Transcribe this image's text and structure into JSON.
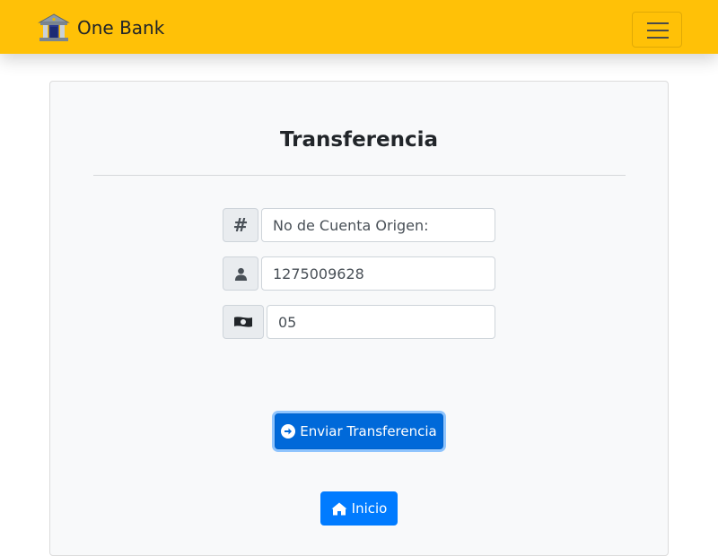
{
  "navbar": {
    "brand_name": "One Bank",
    "brand_icon": "bank-building-icon",
    "toggler_icon": "hamburger-menu-icon",
    "background_color": "#ffc107"
  },
  "form": {
    "title": "Transferencia",
    "source_account": {
      "icon": "hash-icon",
      "icon_glyph": "#",
      "placeholder": "No de Cuenta Origen:",
      "value": ""
    },
    "destination_account": {
      "icon": "user-icon",
      "value": "1275009628"
    },
    "amount": {
      "icon": "money-bill-icon",
      "value": "05"
    },
    "send_button": {
      "label": "Enviar Transferencia",
      "icon": "arrow-circle-right-icon",
      "color": "#0069d9"
    },
    "home_button": {
      "label": "Inicio",
      "icon": "home-icon",
      "color": "#007bff"
    }
  }
}
